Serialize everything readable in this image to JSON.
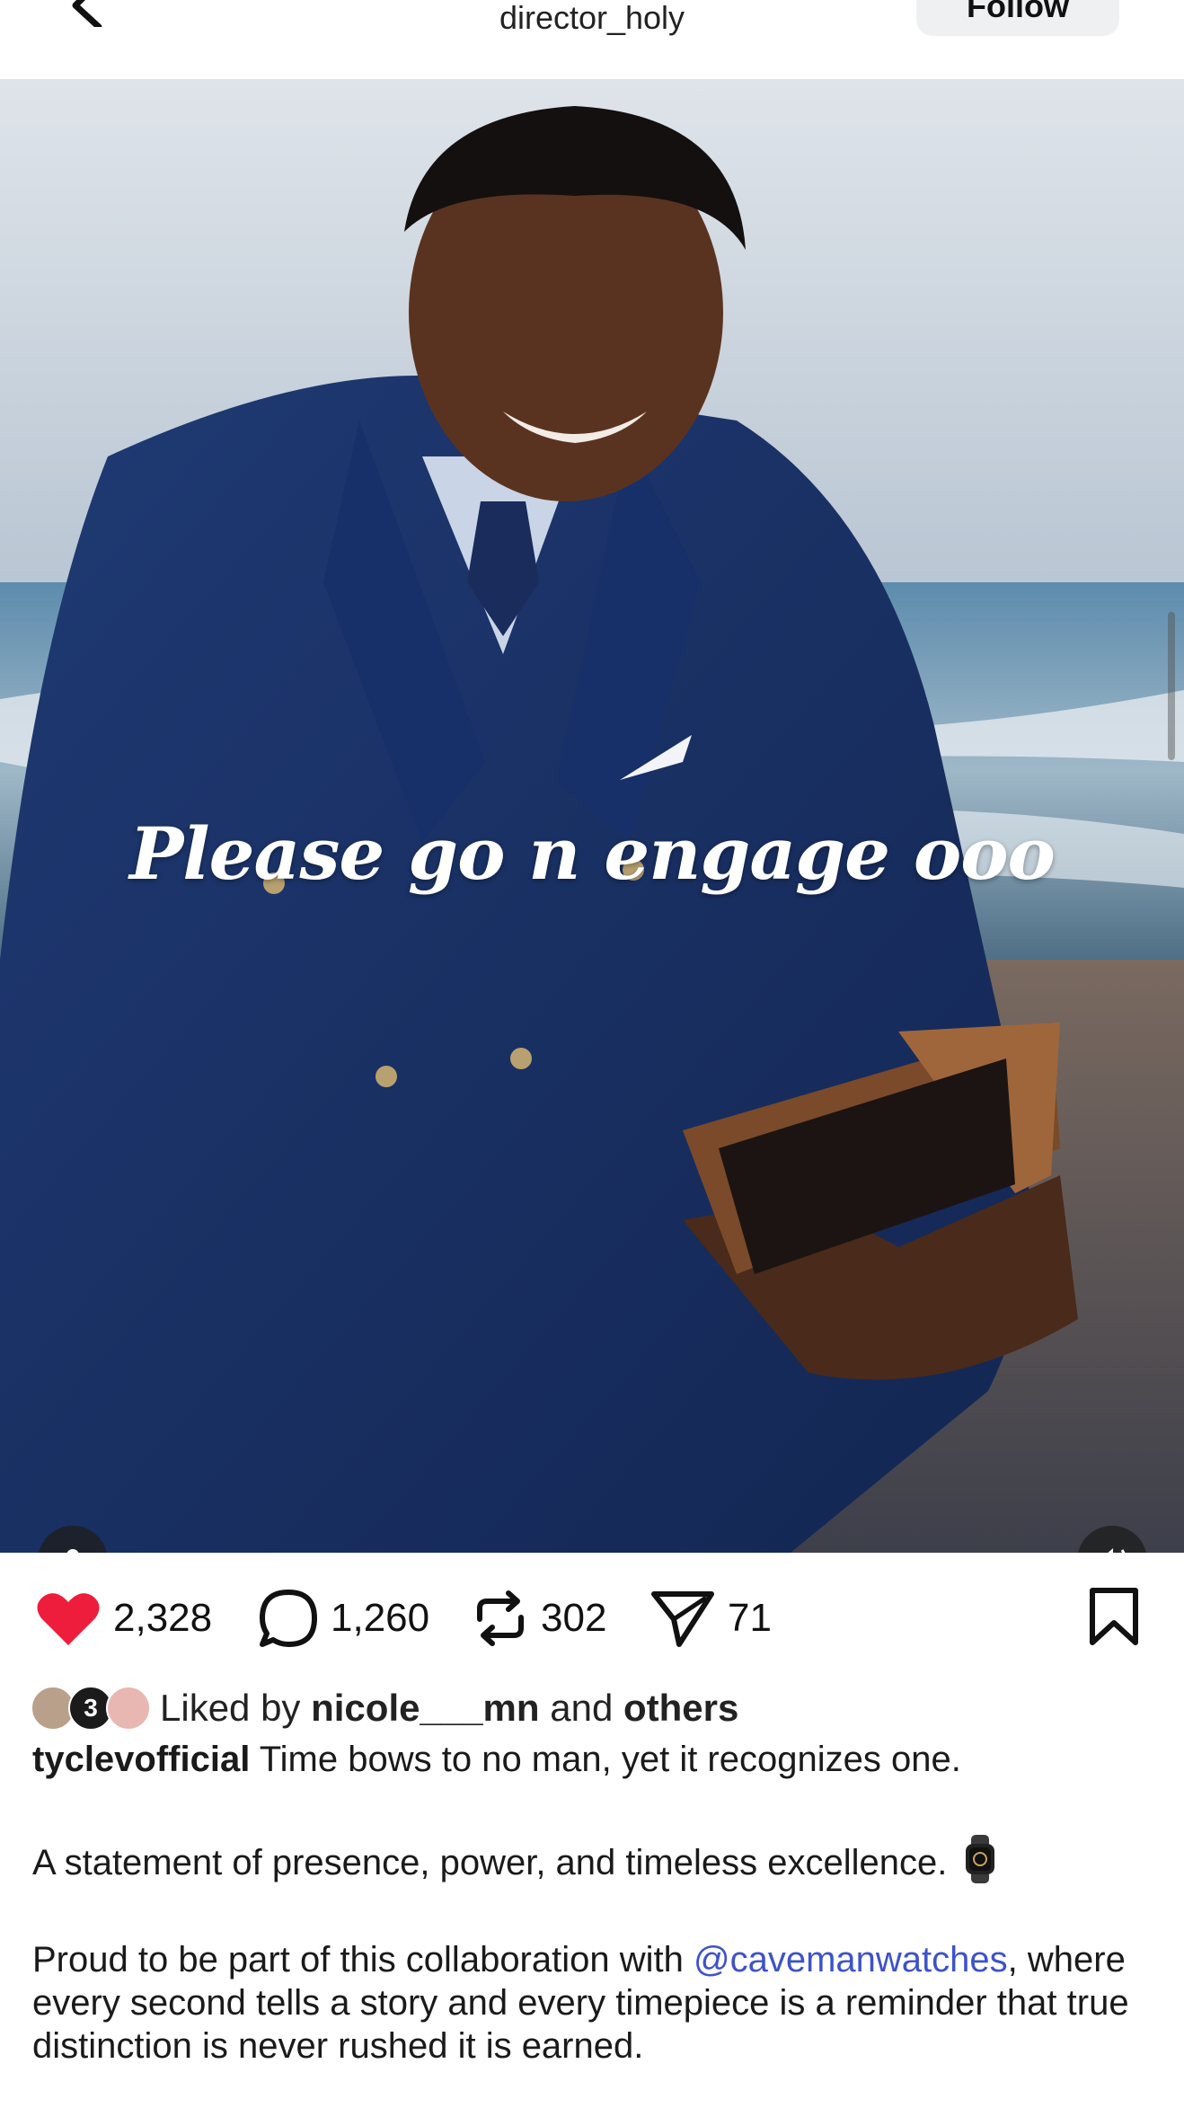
{
  "header": {
    "username": "director_holy",
    "follow_label": "Follow"
  },
  "media": {
    "overlay_text": "Please go n engage ooo",
    "tag_icon": "person-icon",
    "sound_icon": "speaker-icon"
  },
  "actions": {
    "likes": "2,328",
    "comments": "1,260",
    "reposts": "302",
    "shares": "71",
    "liked": true,
    "like_color": "#ee1d3b"
  },
  "likes_line": {
    "prefix": "Liked by",
    "user": "nicole___mn",
    "middle": "and",
    "suffix": "others",
    "avatar_badge": "3"
  },
  "caption": {
    "author": "tyclevofficial",
    "line1": "Time bows to no man, yet it recognizes one.",
    "line2": "A statement of presence, power, and timeless excellence.",
    "line3_before": "Proud to be part of this collaboration with",
    "mention": "@cavemanwatches",
    "line3_after": ", where every second tells a story and every timepiece is a reminder that true distinction is never rushed it is earned.",
    "mention_color": "#3e52c9"
  }
}
